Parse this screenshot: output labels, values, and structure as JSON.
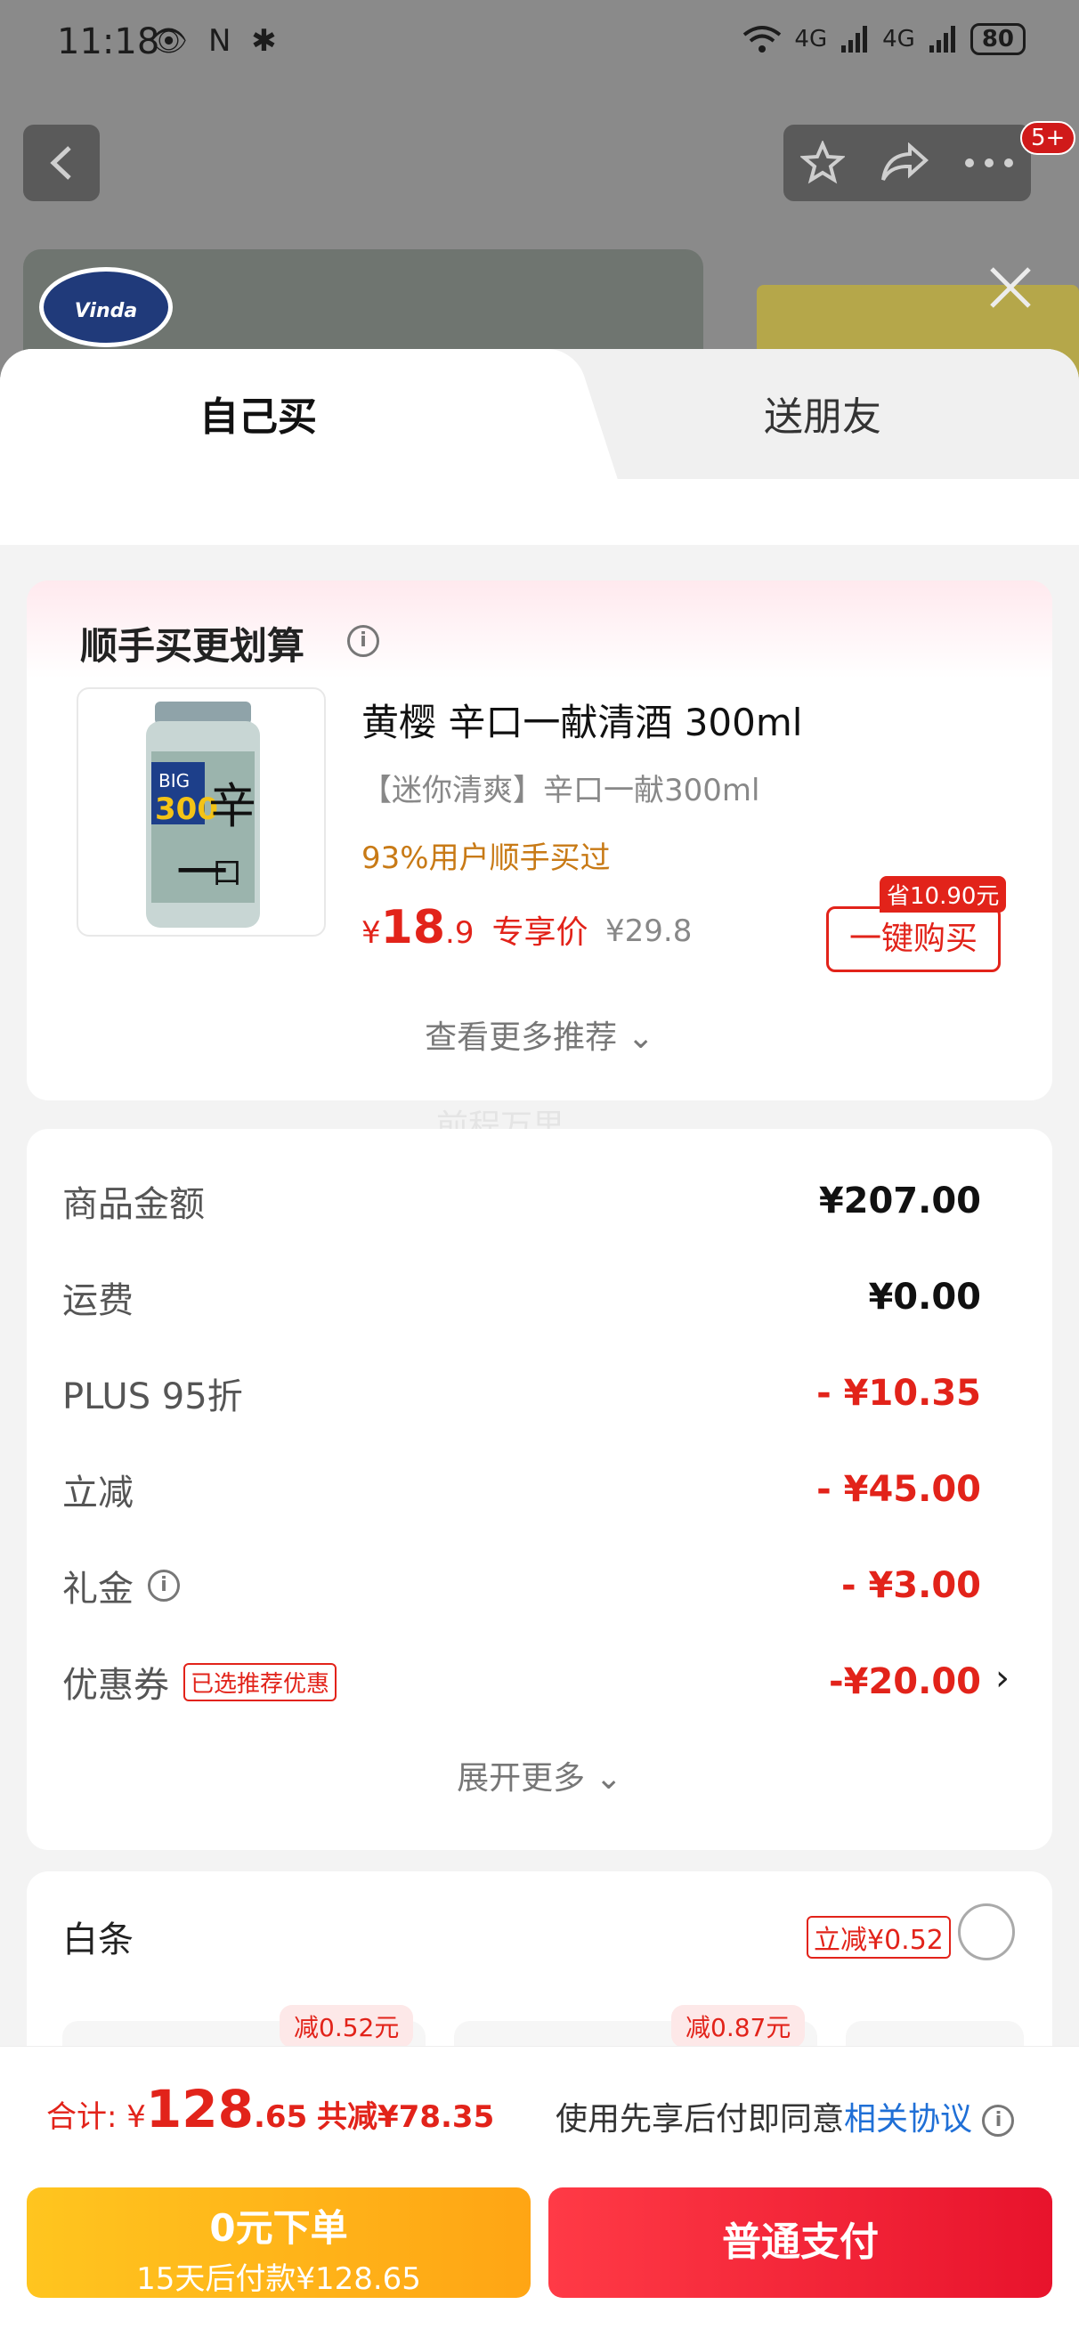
{
  "status_bar": {
    "time": "11:18",
    "icons_left": "👁 N ✱",
    "network_1": "4G",
    "network_2": "4G",
    "battery": "80"
  },
  "header": {
    "cart_badge": "5+"
  },
  "background": {
    "brand_logo_text": "Vinda"
  },
  "tabs": [
    {
      "label": "自己买",
      "active": true
    },
    {
      "label": "送朋友",
      "active": false
    }
  ],
  "recommendation": {
    "title": "顺手买更划算",
    "product_name": "黄樱 辛口一献清酒 300ml",
    "product_subtitle": "【迷你清爽】辛口一献300ml",
    "buy_rate": "93%用户顺手买过",
    "price_symbol": "¥",
    "price_int": "18",
    "price_dec": ".9",
    "price_tag": "专享价",
    "original_price": "¥29.8",
    "save_badge": "省10.90元",
    "buy_button": "一键购买",
    "more_label": "查看更多推荐"
  },
  "watermark": "前程万里",
  "summary": {
    "rows": [
      {
        "label": "商品金额",
        "value": "¥207.00"
      },
      {
        "label": "运费",
        "value": "¥0.00"
      },
      {
        "label": "PLUS 95折",
        "value": "- ¥10.35"
      },
      {
        "label": "立减",
        "value": "- ¥45.00"
      },
      {
        "label": "礼金",
        "value": "- ¥3.00"
      },
      {
        "label": "优惠券",
        "value": "-¥20.00"
      }
    ],
    "coupon_tag": "已选推荐优惠",
    "expand_label": "展开更多"
  },
  "payment": {
    "method": "白条",
    "promo": "立减¥0.52",
    "installment_badges": [
      "减0.52元",
      "减0.87元"
    ]
  },
  "bottom_bar": {
    "total_label": "合计:",
    "total_symbol": "¥",
    "total_int": "128",
    "total_dec": ".65",
    "saved": "共减¥78.35",
    "agree_text": "使用先享后付即同意",
    "agree_link": "相关协议",
    "credit_button_line1": "0元下单",
    "credit_button_line2": "15天后付款¥128.65",
    "normal_button": "普通支付"
  },
  "colors": {
    "accent_red": "#e2231a",
    "link_blue": "#1f6fd6",
    "credit_yellow": "#ffb81a",
    "rate_orange": "#c87a16"
  }
}
